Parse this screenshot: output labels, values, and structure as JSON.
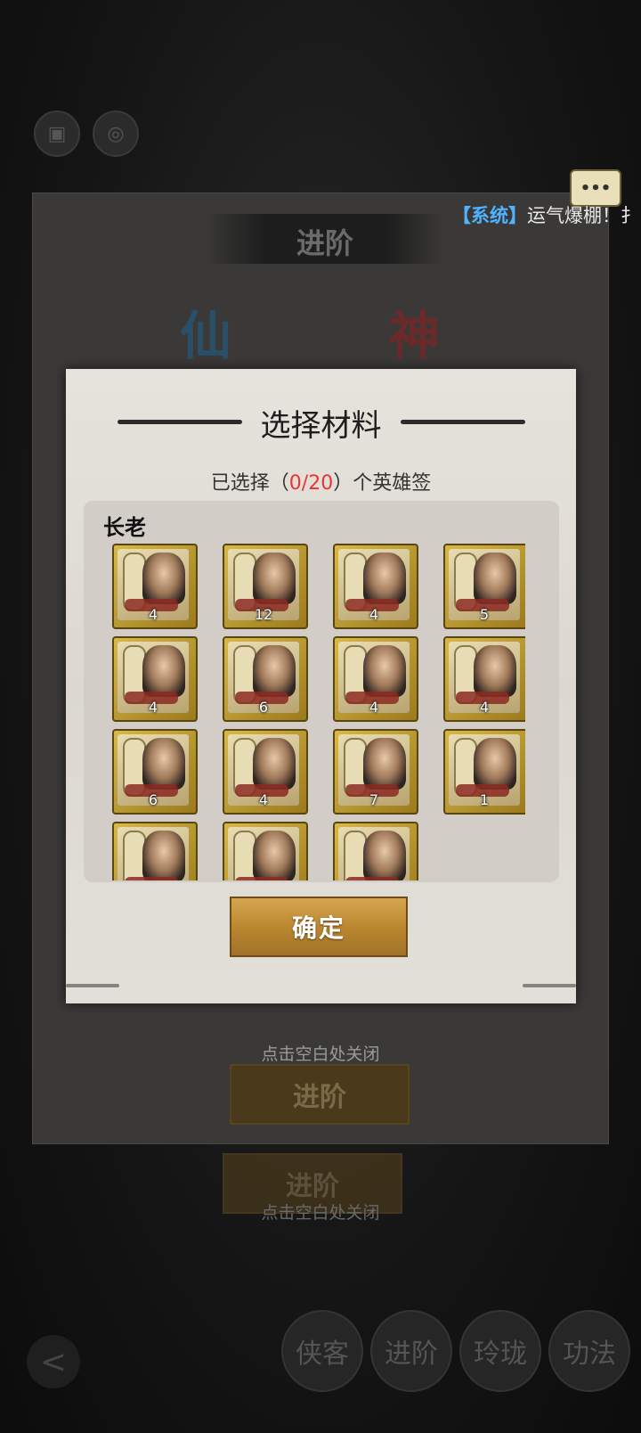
{
  "chat": {
    "tag": "【系统】",
    "message": "运气爆棚！扌"
  },
  "back_panel": {
    "title": "进阶",
    "glyph_left": "仙",
    "glyph_right": "神",
    "close_hint_1": "点击空白处关闭",
    "close_hint_2": "点击空白处关闭",
    "advance_label_1": "进阶",
    "advance_label_2": "进阶"
  },
  "nav": {
    "back_label": "<",
    "items": [
      "侠客",
      "进阶",
      "玲珑",
      "功法"
    ]
  },
  "modal": {
    "title": "选择材料",
    "subtitle_prefix": "已选择（",
    "selected": "0/20",
    "subtitle_suffix": "）个英雄签",
    "group_label": "长老",
    "confirm_label": "确定",
    "cards": [
      {
        "count": "4"
      },
      {
        "count": "12"
      },
      {
        "count": "4"
      },
      {
        "count": "5"
      },
      {
        "count": "4"
      },
      {
        "count": "6"
      },
      {
        "count": "4"
      },
      {
        "count": "4"
      },
      {
        "count": "6"
      },
      {
        "count": "4"
      },
      {
        "count": "7"
      },
      {
        "count": "1"
      },
      {
        "count": ""
      },
      {
        "count": ""
      },
      {
        "count": ""
      }
    ]
  },
  "colors": {
    "accent_red": "#e33333",
    "chat_tag": "#4fb3ff",
    "button_gold": "#c8963e"
  }
}
